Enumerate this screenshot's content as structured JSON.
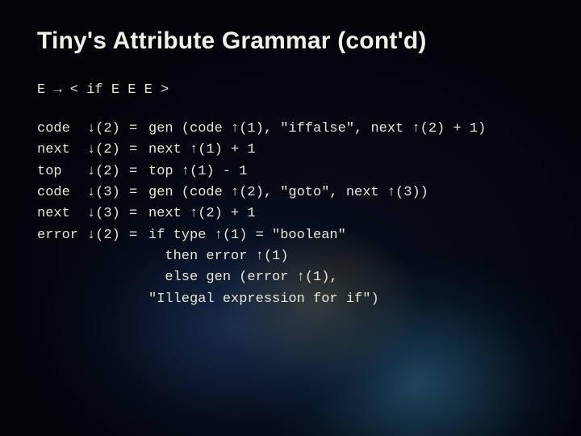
{
  "title": "Tiny's Attribute Grammar (cont'd)",
  "rule": "E → < if E E E >",
  "rows": [
    {
      "attr": "code",
      "ref": "↓(2)",
      "eq": "=",
      "rhs": "gen (code ↑(1), \"iffalse\", next ↑(2) + 1)"
    },
    {
      "attr": "next",
      "ref": "↓(2)",
      "eq": "=",
      "rhs": "next ↑(1) + 1"
    },
    {
      "attr": "top",
      "ref": "↓(2)",
      "eq": "=",
      "rhs": "top ↑(1) - 1"
    },
    {
      "attr": "code",
      "ref": "↓(3)",
      "eq": "=",
      "rhs": "gen (code ↑(2), \"goto\", next ↑(3))"
    },
    {
      "attr": "next",
      "ref": "↓(3)",
      "eq": "=",
      "rhs": "next ↑(2) + 1"
    },
    {
      "attr": "error",
      "ref": "↓(2)",
      "eq": "=",
      "rhs": "if type ↑(1) = \"boolean\"\n  then error ↑(1)\n  else gen (error ↑(1),\n\"Illegal expression for if\")"
    }
  ]
}
